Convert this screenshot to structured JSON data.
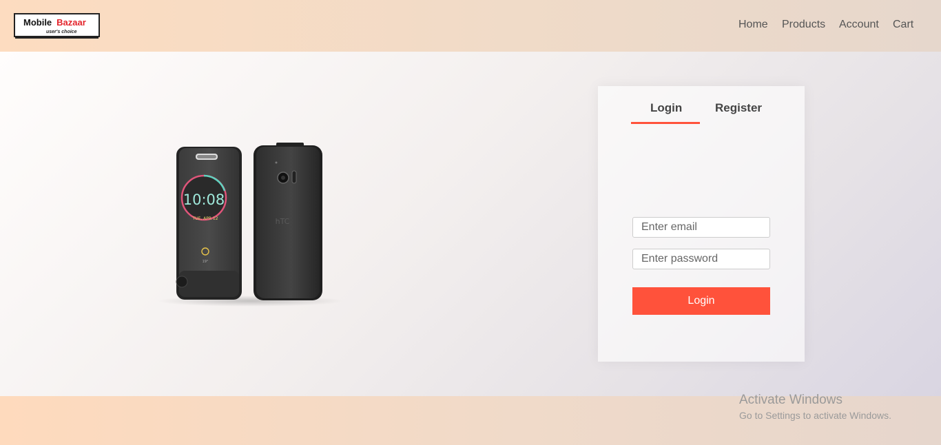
{
  "header": {
    "logo": {
      "brand_part1": "Mobile",
      "brand_part2": "Bazaar",
      "tagline": "user's choice"
    },
    "nav": [
      "Home",
      "Products",
      "Account",
      "Cart"
    ]
  },
  "hero": {
    "phone_screen": {
      "time": "10:08",
      "date": "TUE, APR 12",
      "weather": "19°"
    },
    "phone_back_brand": "hTC"
  },
  "login_form": {
    "tabs": [
      "Login",
      "Register"
    ],
    "active_tab": "Login",
    "email_placeholder": "Enter email",
    "password_placeholder": "Enter password",
    "submit_label": "Login"
  },
  "watermark": {
    "title": "Activate Windows",
    "subtitle": "Go to Settings to activate Windows."
  },
  "colors": {
    "accent": "#ff523b",
    "logo_red": "#e3242b"
  }
}
